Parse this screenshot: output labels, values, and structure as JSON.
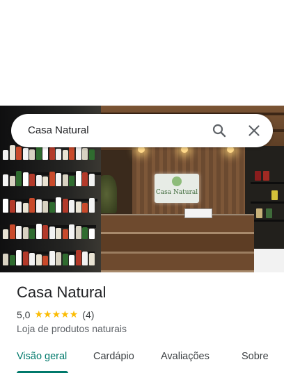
{
  "search": {
    "query": "Casa Natural",
    "search_icon": "search-icon",
    "close_icon": "close-icon"
  },
  "place": {
    "name": "Casa Natural",
    "rating": "5,0",
    "stars": 5,
    "review_count": "(4)",
    "category": "Loja de produtos naturais",
    "photo_sign_text": "Casa Natural"
  },
  "tabs": [
    {
      "label": "Visão geral",
      "active": true
    },
    {
      "label": "Cardápio",
      "active": false
    },
    {
      "label": "Avaliações",
      "active": false
    },
    {
      "label": "Sobre",
      "active": false
    }
  ],
  "colors": {
    "accent": "#00796b",
    "star": "#fbbc04"
  }
}
